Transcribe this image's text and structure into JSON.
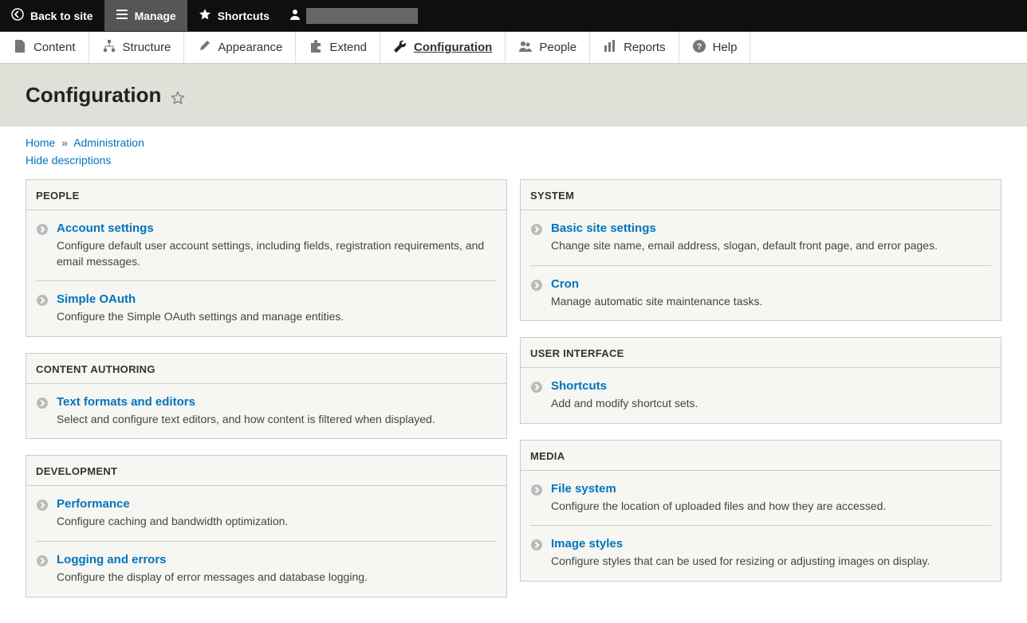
{
  "toolbar": {
    "back": "Back to site",
    "manage": "Manage",
    "shortcuts": "Shortcuts"
  },
  "adminmenu": [
    {
      "id": "content",
      "label": "Content"
    },
    {
      "id": "structure",
      "label": "Structure"
    },
    {
      "id": "appearance",
      "label": "Appearance"
    },
    {
      "id": "extend",
      "label": "Extend"
    },
    {
      "id": "configuration",
      "label": "Configuration"
    },
    {
      "id": "people",
      "label": "People"
    },
    {
      "id": "reports",
      "label": "Reports"
    },
    {
      "id": "help",
      "label": "Help"
    }
  ],
  "page": {
    "title": "Configuration"
  },
  "breadcrumb": {
    "home": "Home",
    "sep": "»",
    "admin": "Administration"
  },
  "hide_descriptions": "Hide descriptions",
  "left_panels": [
    {
      "title": "PEOPLE",
      "items": [
        {
          "label": "Account settings",
          "desc": "Configure default user account settings, including fields, registration requirements, and email messages."
        },
        {
          "label": "Simple OAuth",
          "desc": "Configure the Simple OAuth settings and manage entities."
        }
      ]
    },
    {
      "title": "CONTENT AUTHORING",
      "items": [
        {
          "label": "Text formats and editors",
          "desc": "Select and configure text editors, and how content is filtered when displayed."
        }
      ]
    },
    {
      "title": "DEVELOPMENT",
      "items": [
        {
          "label": "Performance",
          "desc": "Configure caching and bandwidth optimization."
        },
        {
          "label": "Logging and errors",
          "desc": "Configure the display of error messages and database logging."
        }
      ]
    }
  ],
  "right_panels": [
    {
      "title": "SYSTEM",
      "items": [
        {
          "label": "Basic site settings",
          "desc": "Change site name, email address, slogan, default front page, and error pages."
        },
        {
          "label": "Cron",
          "desc": "Manage automatic site maintenance tasks."
        }
      ]
    },
    {
      "title": "USER INTERFACE",
      "items": [
        {
          "label": "Shortcuts",
          "desc": "Add and modify shortcut sets."
        }
      ]
    },
    {
      "title": "MEDIA",
      "items": [
        {
          "label": "File system",
          "desc": "Configure the location of uploaded files and how they are accessed."
        },
        {
          "label": "Image styles",
          "desc": "Configure styles that can be used for resizing or adjusting images on display."
        }
      ]
    }
  ]
}
